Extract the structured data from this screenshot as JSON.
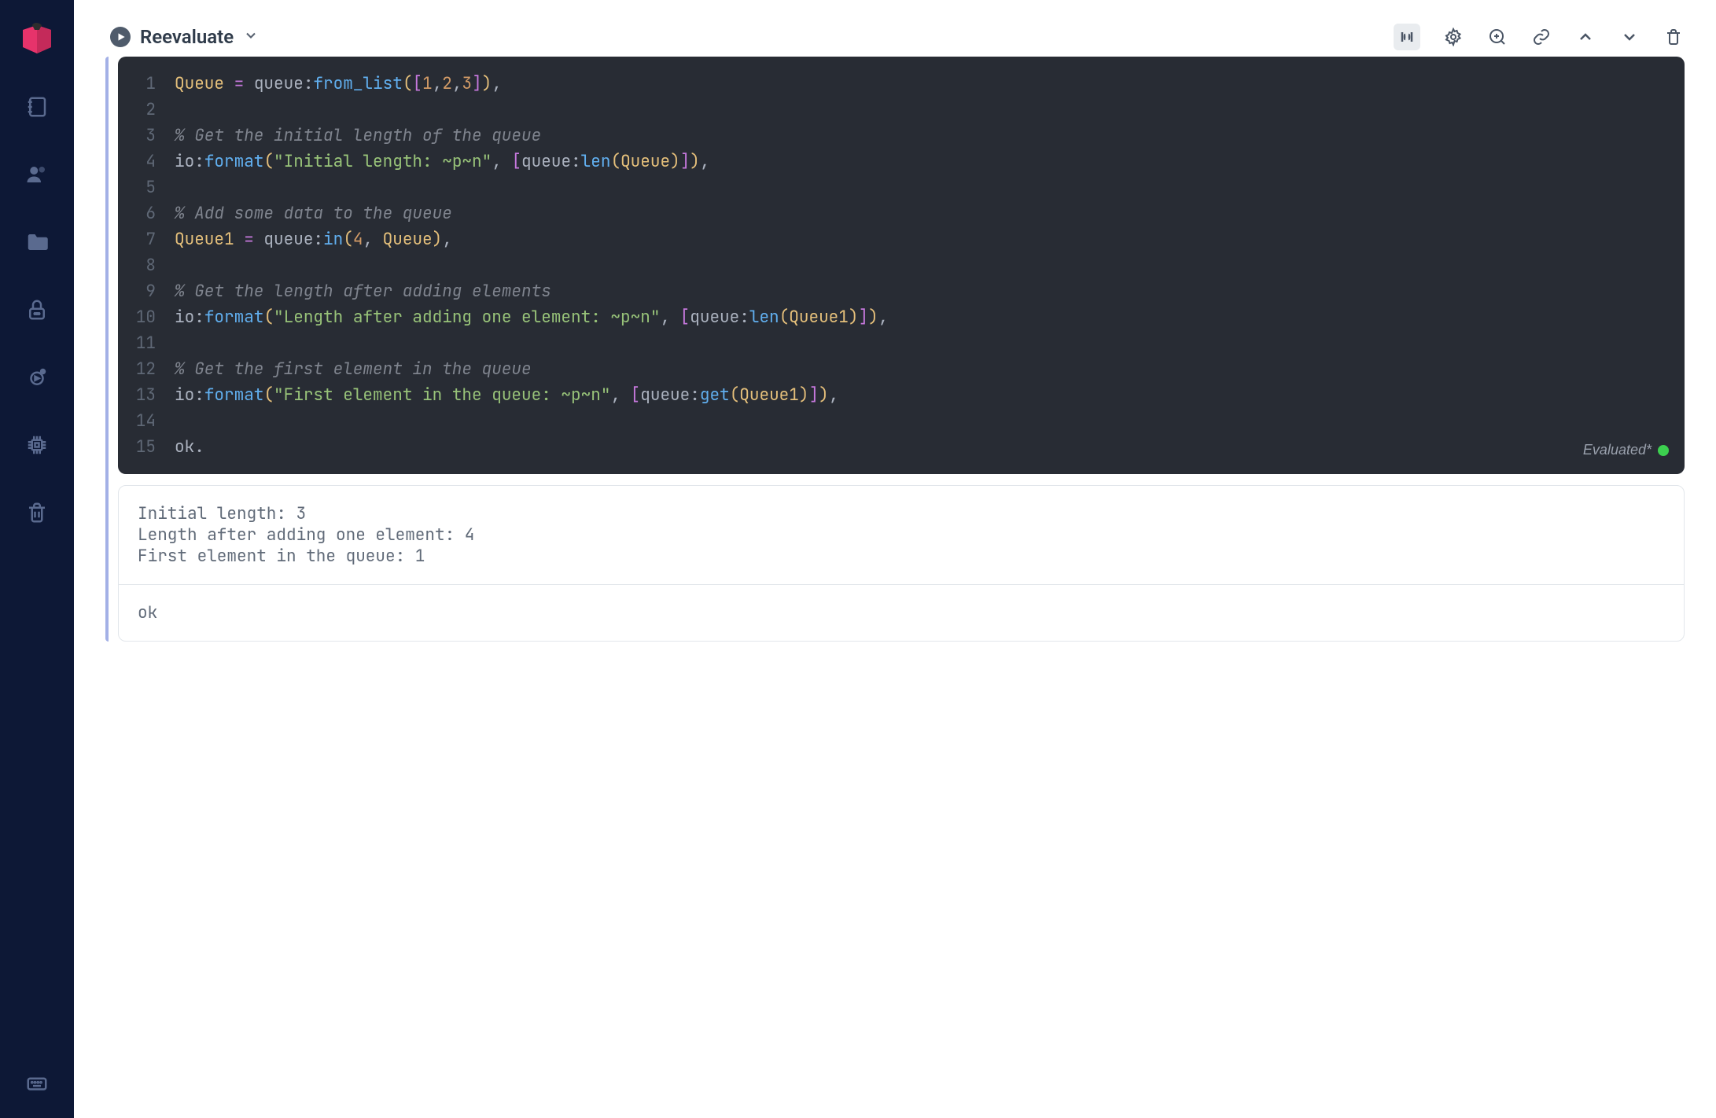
{
  "toolbar": {
    "reevaluate_label": "Reevaluate"
  },
  "editor": {
    "status_label": "Evaluated*",
    "lines": [
      {
        "n": 1,
        "tokens": [
          [
            "var",
            "Queue"
          ],
          [
            "op",
            " "
          ],
          [
            "eq",
            "="
          ],
          [
            "op",
            " queue:"
          ],
          [
            "fn",
            "from_list"
          ],
          [
            "pa",
            "("
          ],
          [
            "br",
            "["
          ],
          [
            "num",
            "1"
          ],
          [
            "op",
            ","
          ],
          [
            "num",
            "2"
          ],
          [
            "op",
            ","
          ],
          [
            "num",
            "3"
          ],
          [
            "br",
            "]"
          ],
          [
            "pa",
            ")"
          ],
          [
            "op",
            ","
          ]
        ]
      },
      {
        "n": 2,
        "tokens": []
      },
      {
        "n": 3,
        "tokens": [
          [
            "cm",
            "% Get the initial length of the queue"
          ]
        ]
      },
      {
        "n": 4,
        "tokens": [
          [
            "op",
            "io:"
          ],
          [
            "fn",
            "format"
          ],
          [
            "pa",
            "("
          ],
          [
            "str",
            "\"Initial length: ~p~n\""
          ],
          [
            "op",
            ", "
          ],
          [
            "br",
            "["
          ],
          [
            "op",
            "queue:"
          ],
          [
            "fn",
            "len"
          ],
          [
            "pa",
            "("
          ],
          [
            "var",
            "Queue"
          ],
          [
            "pa",
            ")"
          ],
          [
            "br",
            "]"
          ],
          [
            "pa",
            ")"
          ],
          [
            "op",
            ","
          ]
        ]
      },
      {
        "n": 5,
        "tokens": []
      },
      {
        "n": 6,
        "tokens": [
          [
            "cm",
            "% Add some data to the queue"
          ]
        ]
      },
      {
        "n": 7,
        "tokens": [
          [
            "var",
            "Queue1"
          ],
          [
            "op",
            " "
          ],
          [
            "eq",
            "="
          ],
          [
            "op",
            " queue:"
          ],
          [
            "fn",
            "in"
          ],
          [
            "pa",
            "("
          ],
          [
            "num",
            "4"
          ],
          [
            "op",
            ", "
          ],
          [
            "var",
            "Queue"
          ],
          [
            "pa",
            ")"
          ],
          [
            "op",
            ","
          ]
        ]
      },
      {
        "n": 8,
        "tokens": []
      },
      {
        "n": 9,
        "tokens": [
          [
            "cm",
            "% Get the length after adding elements"
          ]
        ]
      },
      {
        "n": 10,
        "tokens": [
          [
            "op",
            "io:"
          ],
          [
            "fn",
            "format"
          ],
          [
            "pa",
            "("
          ],
          [
            "str",
            "\"Length after adding one element: ~p~n\""
          ],
          [
            "op",
            ", "
          ],
          [
            "br",
            "["
          ],
          [
            "op",
            "queue:"
          ],
          [
            "fn",
            "len"
          ],
          [
            "pa",
            "("
          ],
          [
            "var",
            "Queue1"
          ],
          [
            "pa",
            ")"
          ],
          [
            "br",
            "]"
          ],
          [
            "pa",
            ")"
          ],
          [
            "op",
            ","
          ]
        ]
      },
      {
        "n": 11,
        "tokens": []
      },
      {
        "n": 12,
        "tokens": [
          [
            "cm",
            "% Get the first element in the queue"
          ]
        ]
      },
      {
        "n": 13,
        "tokens": [
          [
            "op",
            "io:"
          ],
          [
            "fn",
            "format"
          ],
          [
            "pa",
            "("
          ],
          [
            "str",
            "\"First element in the queue: ~p~n\""
          ],
          [
            "op",
            ", "
          ],
          [
            "br",
            "["
          ],
          [
            "op",
            "queue:"
          ],
          [
            "fn",
            "get"
          ],
          [
            "pa",
            "("
          ],
          [
            "var",
            "Queue1"
          ],
          [
            "pa",
            ")"
          ],
          [
            "br",
            "]"
          ],
          [
            "pa",
            ")"
          ],
          [
            "op",
            ","
          ]
        ]
      },
      {
        "n": 14,
        "tokens": []
      },
      {
        "n": 15,
        "tokens": [
          [
            "op",
            "ok."
          ]
        ]
      }
    ]
  },
  "output": {
    "stdout": "Initial length: 3\nLength after adding one element: 4\nFirst element in the queue: 1",
    "result": "ok"
  }
}
